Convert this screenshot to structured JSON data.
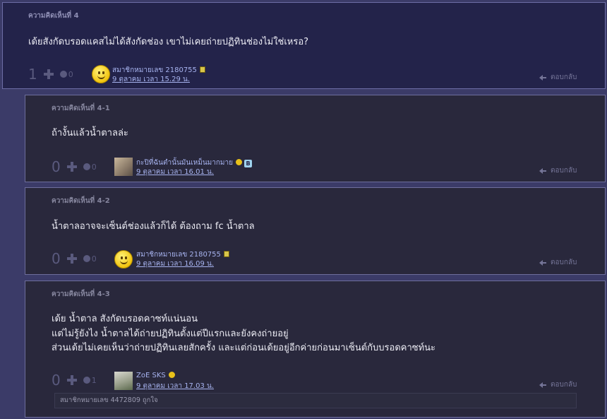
{
  "comments": [
    {
      "title": "ความคิดเห็นที่ 4",
      "lines": [
        "เด้ยสังกัดบรอดแคสไม่ได้สังกัดช่อง   เขาไม่เคยถ่ายปฏิทินช่องไม่ใช่เหรอ?"
      ],
      "vote_count": "1",
      "emotion_count": "0",
      "user": "สมาชิกหมายเลข 2180755",
      "date": "9 ตุลาคม เวลา 15.29 น.",
      "reply_label": "ตอบกลับ"
    },
    {
      "title": "ความคิดเห็นที่ 4-1",
      "lines": [
        "ถ้างั้นแล้วน้ำตาลล่ะ"
      ],
      "vote_count": "0",
      "emotion_count": "0",
      "user": "กะปิที่ฉันตำนั้นมันเหม็นมากมาย",
      "date": "9 ตุลาคม เวลา 16.01 น.",
      "reply_label": "ตอบกลับ",
      "badge_text": "B"
    },
    {
      "title": "ความคิดเห็นที่ 4-2",
      "lines": [
        "น้ำตาลอาจจะเซ็นต์ช่องแล้วก็ได้  ต้องถาม fc น้ำตาล"
      ],
      "vote_count": "0",
      "emotion_count": "0",
      "user": "สมาชิกหมายเลข 2180755",
      "date": "9 ตุลาคม เวลา 16.09 น.",
      "reply_label": "ตอบกลับ"
    },
    {
      "title": "ความคิดเห็นที่ 4-3",
      "lines": [
        "เด้ย น้ำตาล สังกัดบรอดคาซท์แน่นอน",
        "แต่ไม่รู้ยังไง น้ำตาลได้ถ่ายปฏิทินตั้งแต่ปีแรกและยังคงถ่ายอยู่",
        "ส่วนเด้ยไม่เคยเห็นว่าถ่ายปฏิทินเลยสักครั้ง และแต่ก่อนเด้ยอยู่อีกค่ายก่อนมาเซ็นต์กับบรอดคาซท์นะ"
      ],
      "vote_count": "0",
      "emotion_count": "1",
      "user": "ZoE SKS",
      "date": "9 ตุลาคม เวลา 17.03 น.",
      "reply_label": "ตอบกลับ",
      "likes": "สมาชิกหมายเลข 4472809 ถูกใจ"
    }
  ]
}
